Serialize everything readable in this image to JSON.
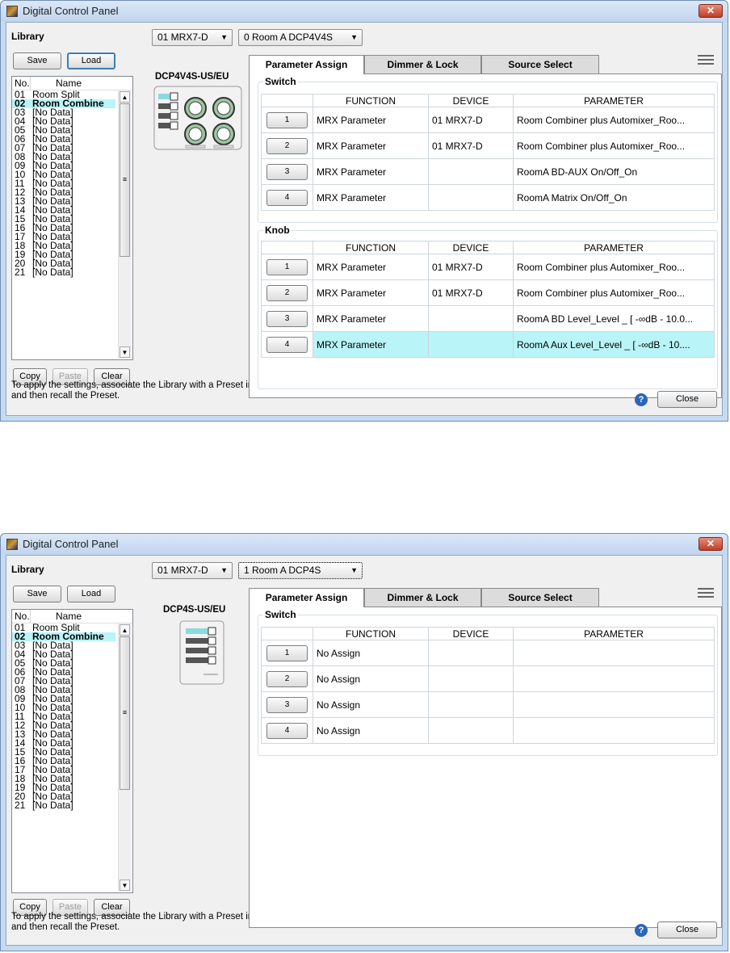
{
  "windows": [
    {
      "title": "Digital Control Panel",
      "close_symbol": "✕",
      "library_label": "Library",
      "device_select": "01 MRX7-D",
      "panel_select": "0 Room A DCP4V4S",
      "buttons": {
        "save": "Save",
        "load": "Load",
        "copy": "Copy",
        "paste": "Paste",
        "clear": "Clear",
        "close": "Close",
        "help": "?"
      },
      "list_header": {
        "no": "No.",
        "name": "Name"
      },
      "list_items": [
        {
          "no": "01",
          "name": "Room Split"
        },
        {
          "no": "02",
          "name": "Room Combine"
        },
        {
          "no": "03",
          "name": "[No Data]"
        },
        {
          "no": "04",
          "name": "[No Data]"
        },
        {
          "no": "05",
          "name": "[No Data]"
        },
        {
          "no": "06",
          "name": "[No Data]"
        },
        {
          "no": "07",
          "name": "[No Data]"
        },
        {
          "no": "08",
          "name": "[No Data]"
        },
        {
          "no": "09",
          "name": "[No Data]"
        },
        {
          "no": "10",
          "name": "[No Data]"
        },
        {
          "no": "11",
          "name": "[No Data]"
        },
        {
          "no": "12",
          "name": "[No Data]"
        },
        {
          "no": "13",
          "name": "[No Data]"
        },
        {
          "no": "14",
          "name": "[No Data]"
        },
        {
          "no": "15",
          "name": "[No Data]"
        },
        {
          "no": "16",
          "name": "[No Data]"
        },
        {
          "no": "17",
          "name": "[No Data]"
        },
        {
          "no": "18",
          "name": "[No Data]"
        },
        {
          "no": "19",
          "name": "[No Data]"
        },
        {
          "no": "20",
          "name": "[No Data]"
        },
        {
          "no": "21",
          "name": "[No Data]"
        }
      ],
      "scroll": {
        "up": "▲",
        "down": "▼",
        "grip": "≡"
      },
      "model_label": "DCP4V4S-US/EU",
      "tabs": [
        "Parameter Assign",
        "Dimmer & Lock",
        "Source Select"
      ],
      "hint_line1": "To apply the settings, associate the Library with a Preset in the Preset dialog,",
      "hint_line2": "and then recall the Preset.",
      "table_headers": {
        "function": "FUNCTION",
        "device": "DEVICE",
        "parameter": "PARAMETER"
      },
      "switch_group": {
        "title": "Switch",
        "rows": [
          {
            "num": "1",
            "function": "MRX Parameter",
            "device": "01 MRX7-D",
            "parameter": "Room Combiner plus Automixer_Roo..."
          },
          {
            "num": "2",
            "function": "MRX Parameter",
            "device": "01 MRX7-D",
            "parameter": "Room Combiner plus Automixer_Roo..."
          },
          {
            "num": "3",
            "function": "MRX Parameter",
            "device": "",
            "parameter": "RoomA BD-AUX On/Off_On"
          },
          {
            "num": "4",
            "function": "MRX Parameter",
            "device": "",
            "parameter": "RoomA Matrix On/Off_On"
          }
        ]
      },
      "knob_group": {
        "title": "Knob",
        "rows": [
          {
            "num": "1",
            "function": "MRX Parameter",
            "device": "01 MRX7-D",
            "parameter": "Room Combiner plus Automixer_Roo..."
          },
          {
            "num": "2",
            "function": "MRX Parameter",
            "device": "01 MRX7-D",
            "parameter": "Room Combiner plus Automixer_Roo..."
          },
          {
            "num": "3",
            "function": "MRX Parameter",
            "device": "",
            "parameter": "RoomA BD Level_Level _ [ -∞dB - 10.0..."
          },
          {
            "num": "4",
            "function": "MRX Parameter",
            "device": "",
            "parameter": "RoomA Aux Level_Level _ [ -∞dB - 10...."
          }
        ]
      }
    },
    {
      "title": "Digital Control Panel",
      "close_symbol": "✕",
      "library_label": "Library",
      "device_select": "01 MRX7-D",
      "panel_select": "1 Room A DCP4S",
      "buttons": {
        "save": "Save",
        "load": "Load",
        "copy": "Copy",
        "paste": "Paste",
        "clear": "Clear",
        "close": "Close",
        "help": "?"
      },
      "list_header": {
        "no": "No.",
        "name": "Name"
      },
      "list_items": [
        {
          "no": "01",
          "name": "Room Split"
        },
        {
          "no": "02",
          "name": "Room Combine"
        },
        {
          "no": "03",
          "name": "[No Data]"
        },
        {
          "no": "04",
          "name": "[No Data]"
        },
        {
          "no": "05",
          "name": "[No Data]"
        },
        {
          "no": "06",
          "name": "[No Data]"
        },
        {
          "no": "07",
          "name": "[No Data]"
        },
        {
          "no": "08",
          "name": "[No Data]"
        },
        {
          "no": "09",
          "name": "[No Data]"
        },
        {
          "no": "10",
          "name": "[No Data]"
        },
        {
          "no": "11",
          "name": "[No Data]"
        },
        {
          "no": "12",
          "name": "[No Data]"
        },
        {
          "no": "13",
          "name": "[No Data]"
        },
        {
          "no": "14",
          "name": "[No Data]"
        },
        {
          "no": "15",
          "name": "[No Data]"
        },
        {
          "no": "16",
          "name": "[No Data]"
        },
        {
          "no": "17",
          "name": "[No Data]"
        },
        {
          "no": "18",
          "name": "[No Data]"
        },
        {
          "no": "19",
          "name": "[No Data]"
        },
        {
          "no": "20",
          "name": "[No Data]"
        },
        {
          "no": "21",
          "name": "[No Data]"
        }
      ],
      "scroll": {
        "up": "▲",
        "down": "▼",
        "grip": "≡"
      },
      "model_label": "DCP4S-US/EU",
      "tabs": [
        "Parameter Assign",
        "Dimmer & Lock",
        "Source Select"
      ],
      "hint_line1": "To apply the settings, associate the Library with a Preset in the Preset dialog,",
      "hint_line2": "and then recall the Preset.",
      "table_headers": {
        "function": "FUNCTION",
        "device": "DEVICE",
        "parameter": "PARAMETER"
      },
      "switch_group": {
        "title": "Switch",
        "rows": [
          {
            "num": "1",
            "function": "No Assign",
            "device": "",
            "parameter": ""
          },
          {
            "num": "2",
            "function": "No Assign",
            "device": "",
            "parameter": ""
          },
          {
            "num": "3",
            "function": "No Assign",
            "device": "",
            "parameter": ""
          },
          {
            "num": "4",
            "function": "No Assign",
            "device": "",
            "parameter": ""
          }
        ]
      }
    }
  ]
}
